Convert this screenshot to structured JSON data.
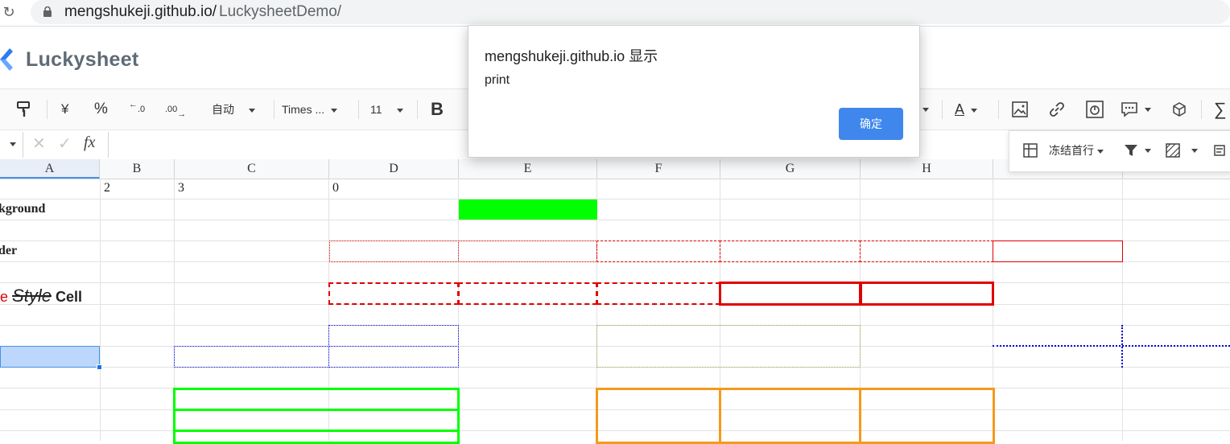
{
  "browser": {
    "url_host": "mengshukeji.github.io/",
    "url_path": "LuckysheetDemo/"
  },
  "app": {
    "name": "Luckysheet",
    "brand_color": "#1a73e8"
  },
  "toolbar": {
    "currency": "¥",
    "percent": "%",
    "decimal_decrease": ".0",
    "decimal_increase": ".00",
    "number_format": "自动",
    "font_name": "Times ...",
    "font_size": "11",
    "bold": "B",
    "font_color_letter": "A"
  },
  "subtoolbar": {
    "freeze_label": "冻结首行"
  },
  "formula_bar": {
    "fx_label": "fx"
  },
  "grid": {
    "columns": [
      "A",
      "B",
      "C",
      "D",
      "E",
      "F",
      "G",
      "H"
    ],
    "row1": {
      "b": "2",
      "c": "3",
      "d": "0"
    },
    "row2_a": "kground",
    "row4_a": "der",
    "row6_a_red": "e",
    "row6_a_style": "Style",
    "row6_a_cell": "Cell",
    "green_fill": "#00ff00",
    "selection_fill": "#bcd7fb"
  },
  "dialog": {
    "title": "mengshukeji.github.io 显示",
    "message": "print",
    "ok_label": "确定",
    "ok_color": "#3f87ec"
  }
}
